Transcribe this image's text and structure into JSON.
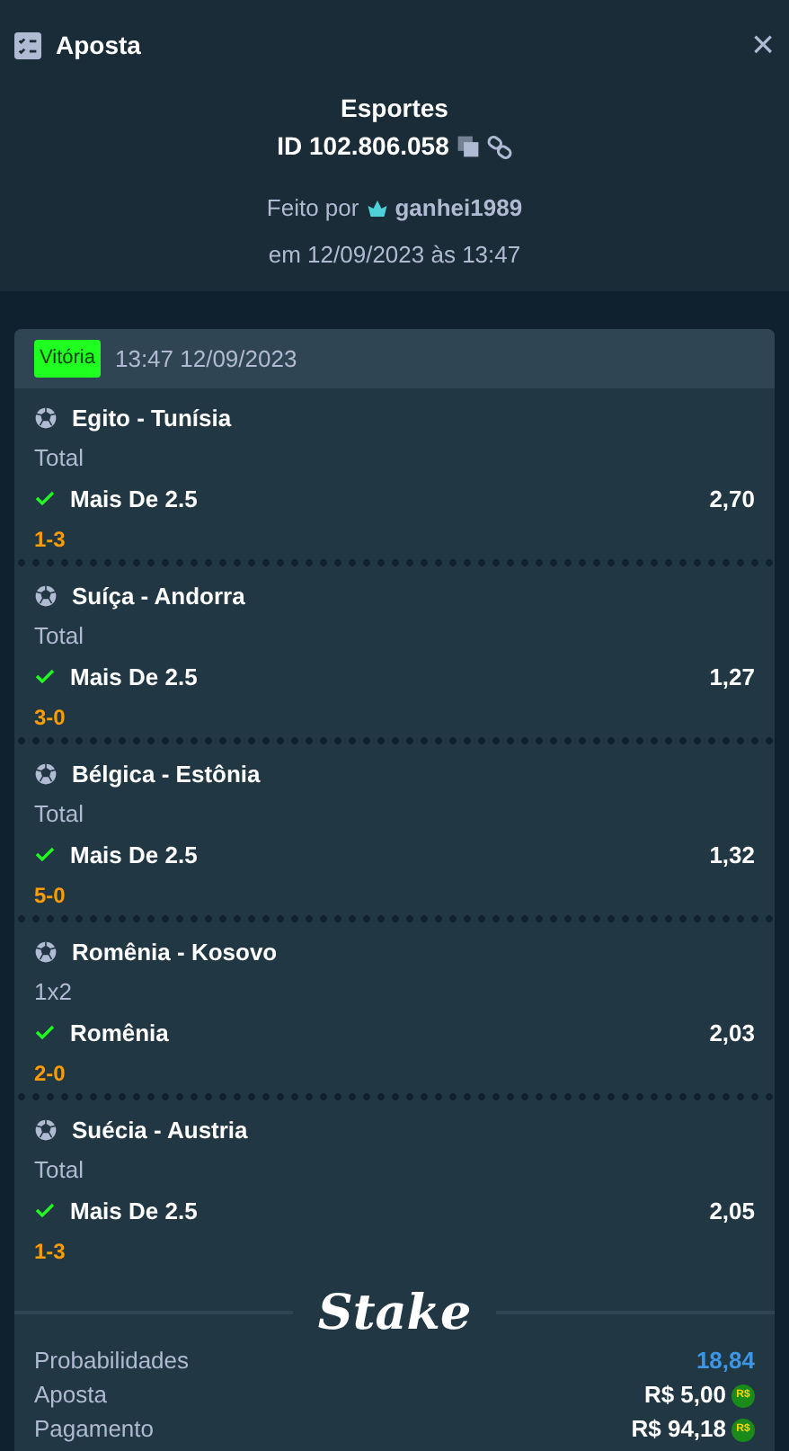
{
  "header": {
    "title": "Aposta",
    "close": "×"
  },
  "summary": {
    "category": "Esportes",
    "bet_id": "ID 102.806.058",
    "placed_by_label": "Feito por",
    "username": "ganhei1989",
    "placed_at": "em 12/09/2023 às 13:47"
  },
  "bet": {
    "status": "Vitória",
    "won": true,
    "timestamp": "13:47 12/09/2023",
    "legs": [
      {
        "match": "Egito - Tunísia",
        "market": "Total",
        "selection": "Mais De 2.5",
        "odds": "2,70",
        "score": "1-3",
        "won": true
      },
      {
        "match": "Suíça - Andorra",
        "market": "Total",
        "selection": "Mais De 2.5",
        "odds": "1,27",
        "score": "3-0",
        "won": true
      },
      {
        "match": "Bélgica - Estônia",
        "market": "Total",
        "selection": "Mais De 2.5",
        "odds": "1,32",
        "score": "5-0",
        "won": true
      },
      {
        "match": "Romênia - Kosovo",
        "market": "1x2",
        "selection": "Romênia",
        "odds": "2,03",
        "score": "2-0",
        "won": true
      },
      {
        "match": "Suécia - Austria",
        "market": "Total",
        "selection": "Mais De 2.5",
        "odds": "2,05",
        "score": "1-3",
        "won": true
      }
    ],
    "brand": "Stake",
    "totals": [
      {
        "label": "Probabilidades",
        "value": "18,84",
        "kind": "odds"
      },
      {
        "label": "Aposta",
        "value": "R$ 5,00",
        "kind": "money",
        "coin": "R$"
      },
      {
        "label": "Pagamento",
        "value": "R$ 94,18",
        "kind": "money",
        "coin": "R$"
      }
    ]
  }
}
